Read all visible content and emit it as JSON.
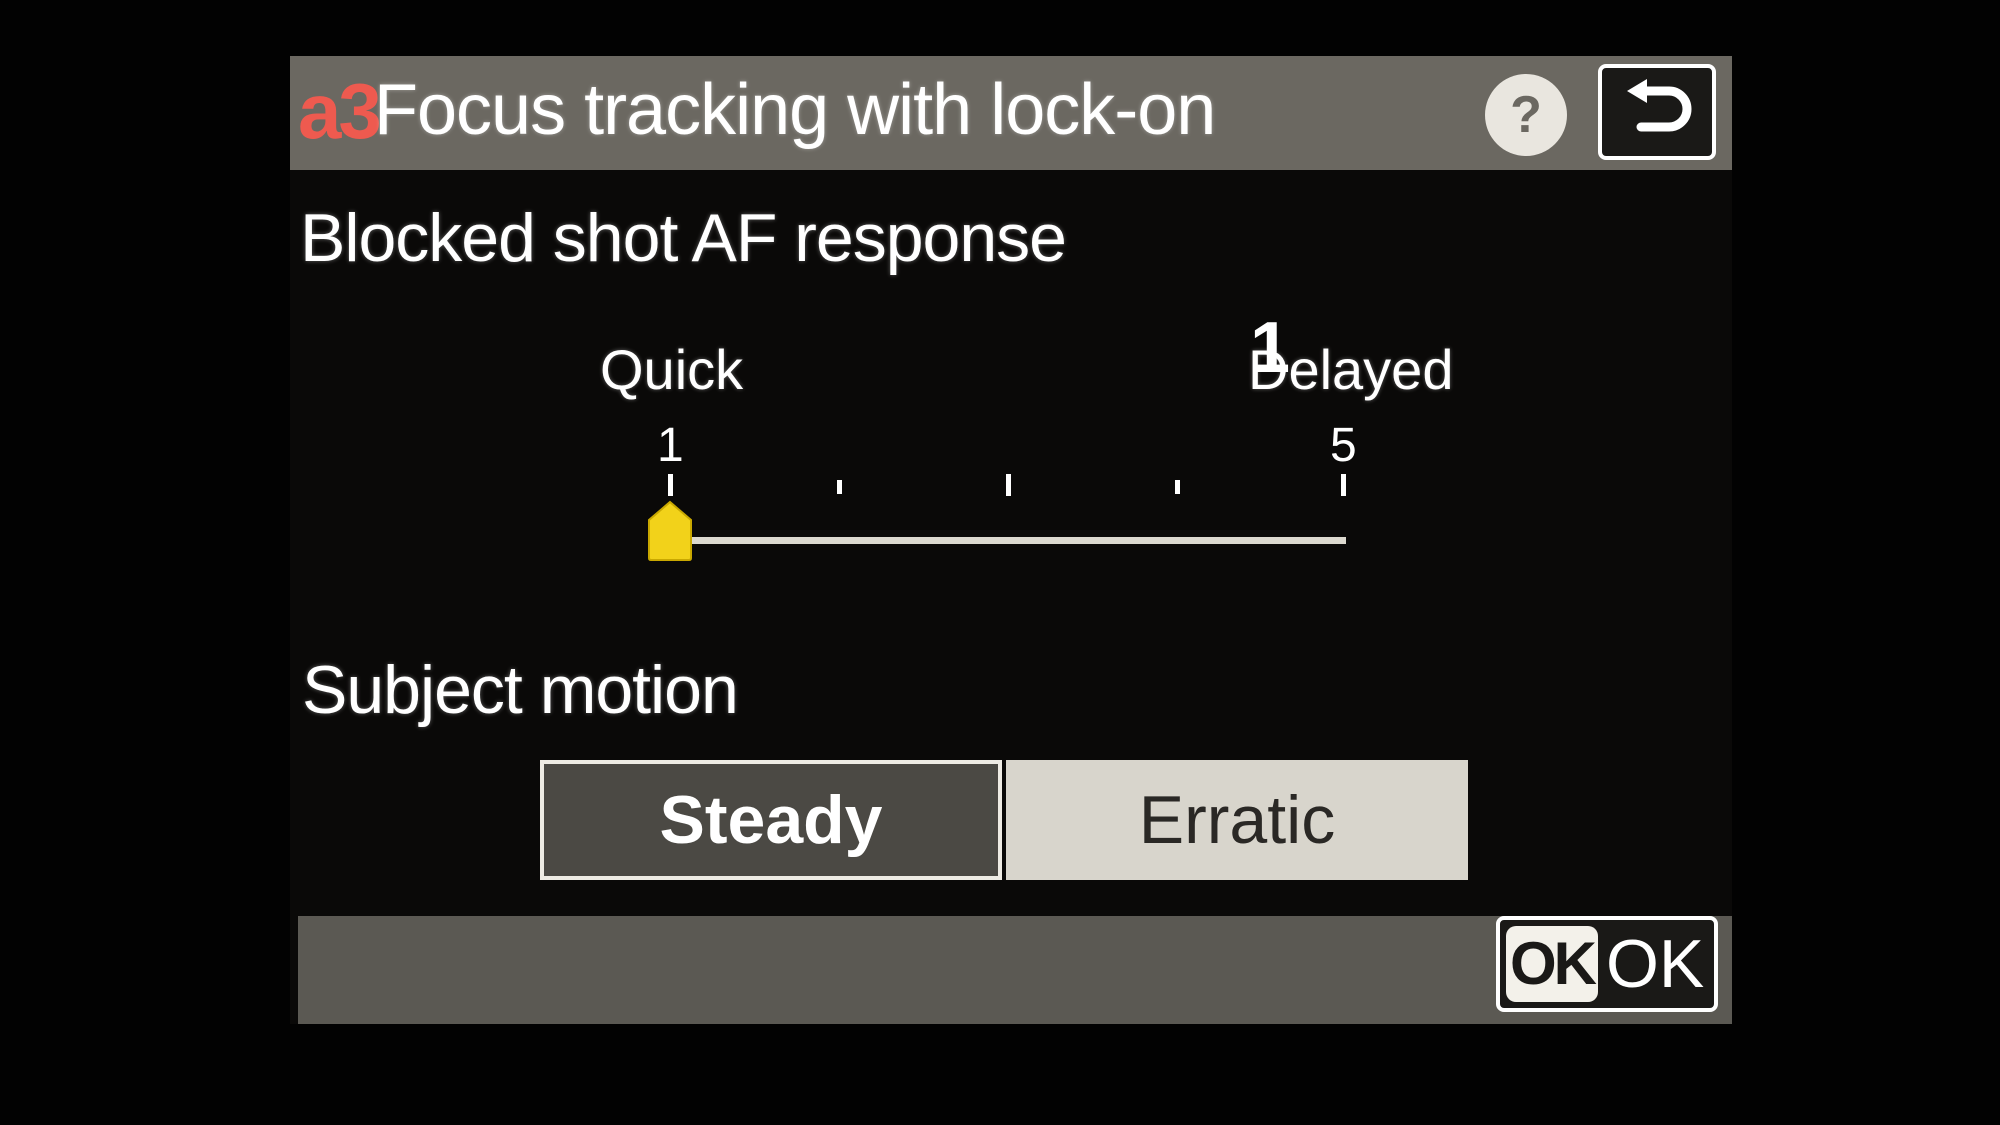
{
  "header": {
    "menu_code": "a3",
    "title": "Focus tracking with lock-on",
    "help_icon_glyph": "?"
  },
  "blocked_shot": {
    "label": "Blocked shot AF response",
    "current_value": "1",
    "left_label": "Quick",
    "right_label": "Delayed",
    "min_label": "1",
    "max_label": "5",
    "min": 1,
    "max": 5,
    "value": 1
  },
  "subject_motion": {
    "label": "Subject motion",
    "options": [
      "Steady",
      "Erratic"
    ],
    "selected": "Steady"
  },
  "footer": {
    "ok_icon_text": "OK",
    "ok_label": "OK"
  },
  "colors": {
    "header_bg": "#6b6861",
    "menu_code": "#ee5a4f",
    "marker": "#f2d21a",
    "selected_segment": "#4b4944",
    "unselected_segment": "#d8d5cc"
  }
}
